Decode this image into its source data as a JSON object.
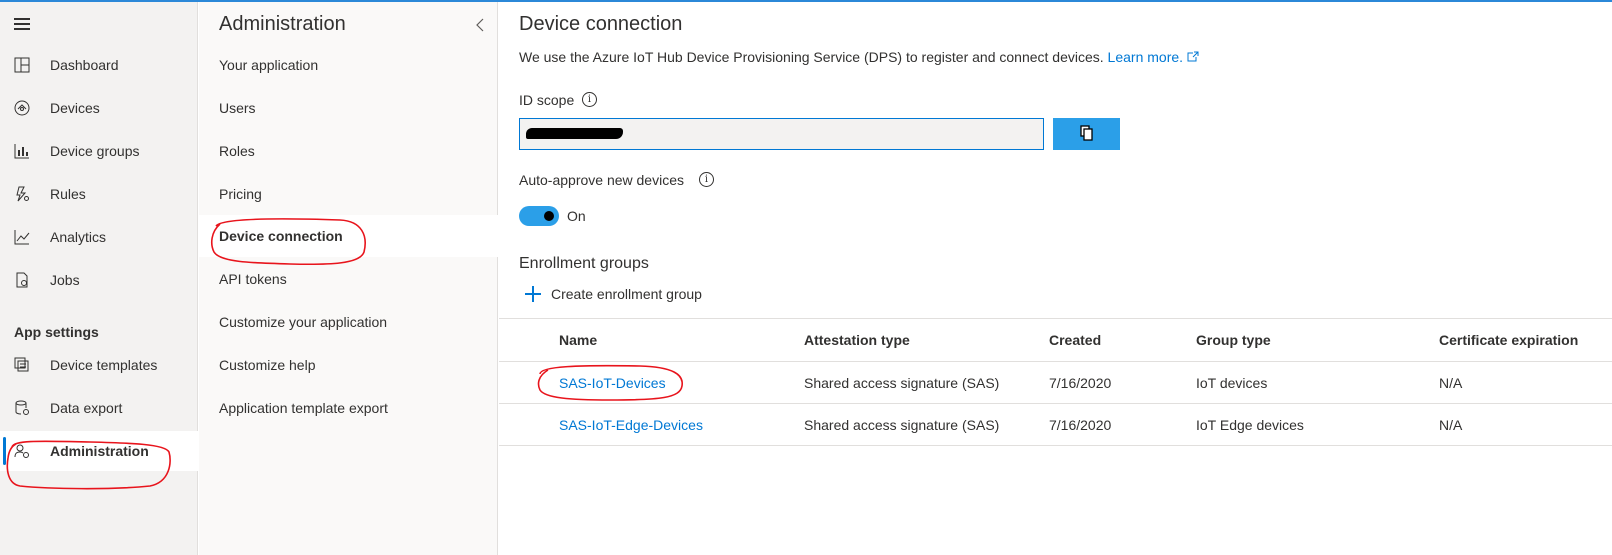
{
  "nav": {
    "items": [
      {
        "label": "Dashboard",
        "icon": "dashboard-icon"
      },
      {
        "label": "Devices",
        "icon": "devices-icon"
      },
      {
        "label": "Device groups",
        "icon": "device-groups-icon"
      },
      {
        "label": "Rules",
        "icon": "rules-icon"
      },
      {
        "label": "Analytics",
        "icon": "analytics-icon"
      },
      {
        "label": "Jobs",
        "icon": "jobs-icon"
      }
    ],
    "section_label": "App settings",
    "settings_items": [
      {
        "label": "Device templates",
        "icon": "device-templates-icon"
      },
      {
        "label": "Data export",
        "icon": "data-export-icon"
      },
      {
        "label": "Administration",
        "icon": "administration-icon"
      }
    ]
  },
  "admin": {
    "title": "Administration",
    "items": [
      "Your application",
      "Users",
      "Roles",
      "Pricing",
      "Device connection",
      "API tokens",
      "Customize your application",
      "Customize help",
      "Application template export"
    ],
    "active": "Device connection"
  },
  "main": {
    "title": "Device connection",
    "description": "We use the Azure IoT Hub Device Provisioning Service (DPS) to register and connect devices.",
    "learn_more": "Learn more.",
    "id_scope_label": "ID scope",
    "auto_approve_label": "Auto-approve new devices",
    "toggle_state": "On",
    "enrollment_title": "Enrollment groups",
    "create_label": "Create enrollment group"
  },
  "table": {
    "headers": [
      "Name",
      "Attestation type",
      "Created",
      "Group type",
      "Certificate expiration"
    ],
    "rows": [
      [
        "SAS-IoT-Devices",
        "Shared access signature (SAS)",
        "7/16/2020",
        "IoT devices",
        "N/A"
      ],
      [
        "SAS-IoT-Edge-Devices",
        "Shared access signature (SAS)",
        "7/16/2020",
        "IoT Edge devices",
        "N/A"
      ]
    ]
  },
  "colors": {
    "accent": "#0078d4",
    "annotation": "#e8141c",
    "button": "#2b9fe8"
  }
}
